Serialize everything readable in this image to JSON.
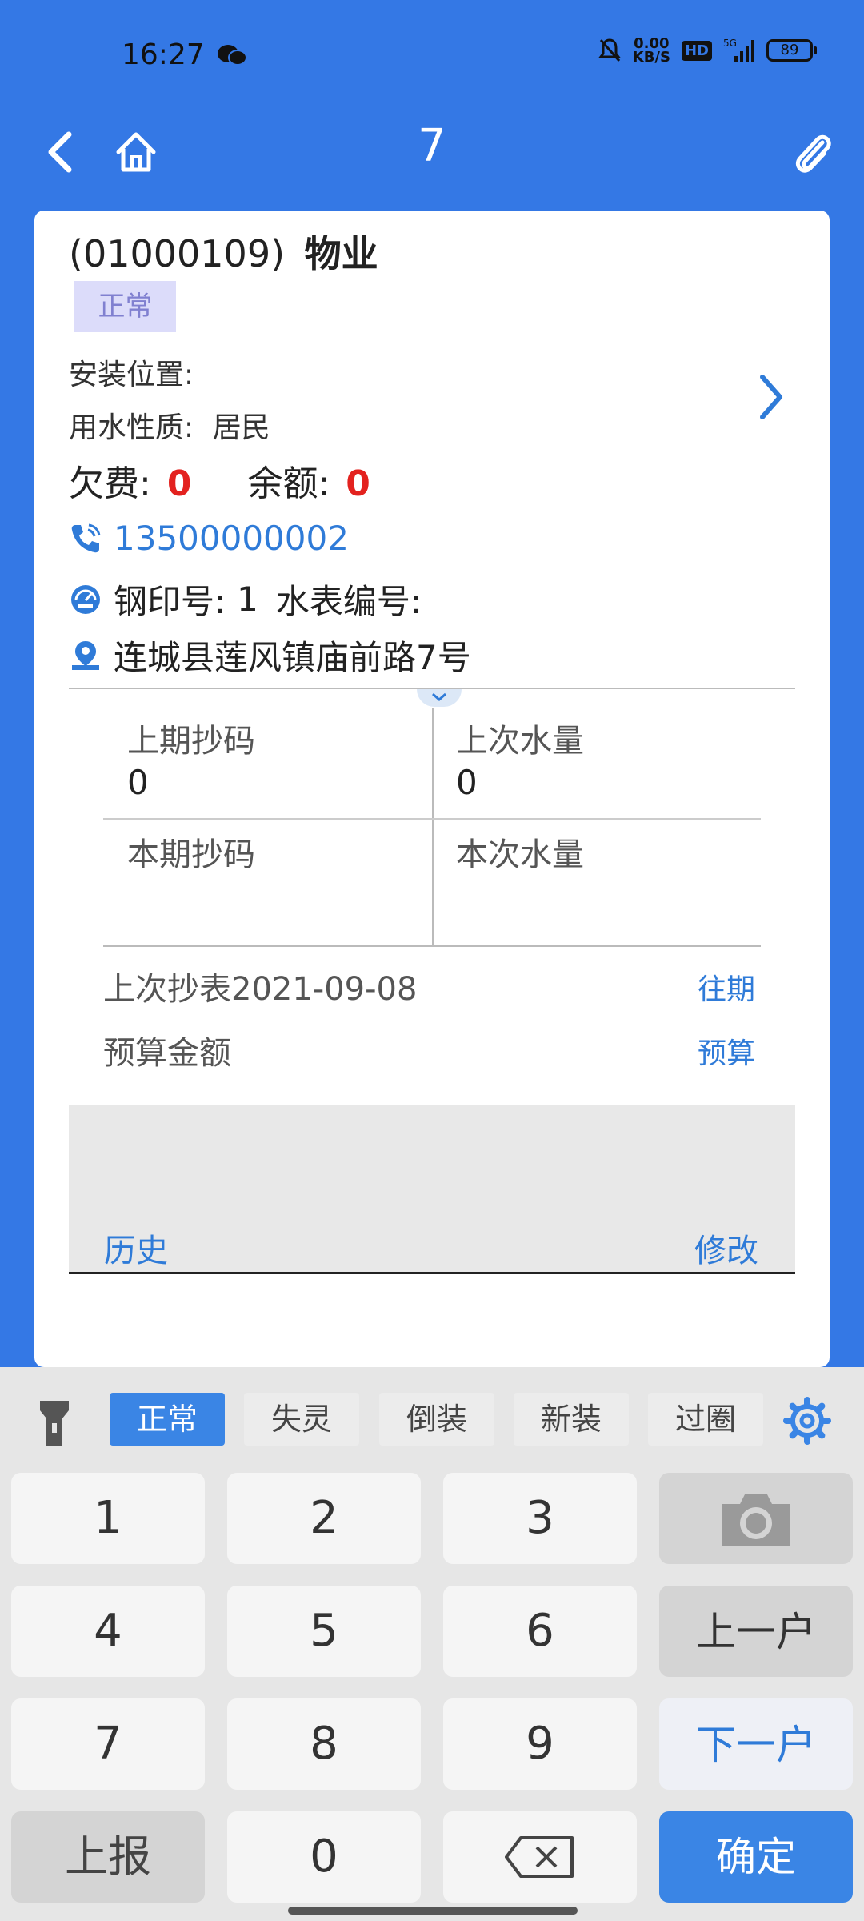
{
  "status_bar": {
    "time": "16:27",
    "net_speed_value": "0.00",
    "net_speed_unit": "KB/S",
    "hd_label": "HD",
    "network": "5G",
    "battery": "89"
  },
  "header": {
    "title": "7"
  },
  "account": {
    "code": "(01000109)",
    "name": "物业",
    "status_badge": "正常",
    "install_location_label": "安装位置:",
    "water_type_label": "用水性质:",
    "water_type_value": "居民",
    "arrears_label": "欠费:",
    "arrears_value": "0",
    "balance_label": "余额:",
    "balance_value": "0",
    "phone": "13500000002",
    "stamp_label": "钢印号:",
    "stamp_value": "1",
    "meter_no_label": "水表编号:",
    "address": "连城县莲风镇庙前路7号"
  },
  "readings": {
    "prev_reading_label": "上期抄码",
    "prev_reading_value": "0",
    "prev_usage_label": "上次水量",
    "prev_usage_value": "0",
    "curr_reading_label": "本期抄码",
    "curr_usage_label": "本次水量"
  },
  "details": {
    "last_read": "上次抄表2021-09-08",
    "history_link": "往期",
    "budget_label": "预算金额",
    "budget_link": "预算",
    "history_button": "历史",
    "edit_button": "修改"
  },
  "keyboard": {
    "status_options": [
      "正常",
      "失灵",
      "倒装",
      "新装",
      "过圈"
    ],
    "selected_status": "正常",
    "digits": [
      "1",
      "2",
      "3",
      "4",
      "5",
      "6",
      "7",
      "8",
      "9",
      "0"
    ],
    "prev_household": "上一户",
    "next_household": "下一户",
    "report": "上报",
    "confirm": "确定"
  },
  "colors": {
    "brand_blue": "#3478e5",
    "accent_red": "#e3221f",
    "link_blue": "#2f7bd8"
  }
}
